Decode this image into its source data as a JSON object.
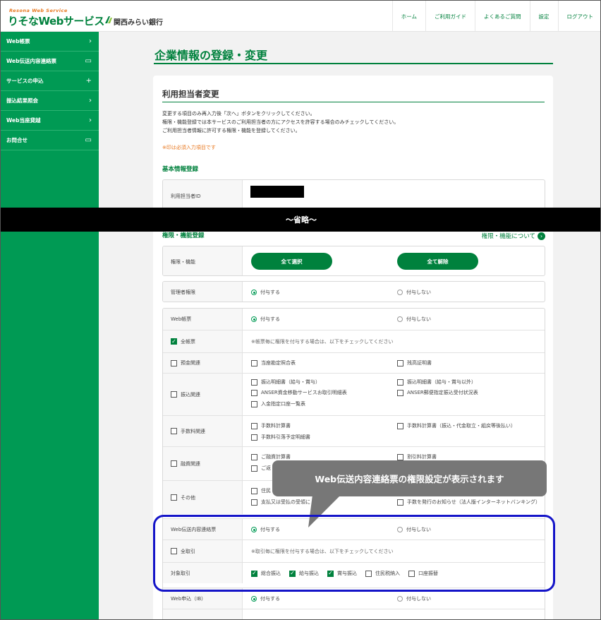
{
  "header": {
    "logo_tagline": "Resona Web Service",
    "logo_main": "りそなWebサービス",
    "bank_name": "関西みらい銀行",
    "nav": [
      "ホーム",
      "ご利用ガイド",
      "よくあるご質問",
      "設定",
      "ログアウト"
    ]
  },
  "sidebar": {
    "items": [
      {
        "label": "Web帳票",
        "icon": "chevron-right-icon",
        "glyph": "›"
      },
      {
        "label": "Web伝送内容連絡票",
        "icon": "window-icon",
        "glyph": "▭"
      },
      {
        "label": "サービスの申込",
        "icon": "plus-icon",
        "glyph": "+"
      },
      {
        "label": "振込結果照会",
        "icon": "chevron-right-icon",
        "glyph": "›"
      },
      {
        "label": "Web当座貸越",
        "icon": "chevron-right-icon",
        "glyph": "›"
      },
      {
        "label": "お問合せ",
        "icon": "window-icon",
        "glyph": "▭"
      }
    ]
  },
  "main": {
    "page_title": "企業情報の登録・変更",
    "section_title": "利用担当者変更",
    "instructions": [
      "変更する項目のみ再入力後「次へ」ボタンをクリックしてください。",
      "権限・機能登録では本サービスのご利用担当者の方にアクセスを許容する場合のみチェックしてください。",
      "ご利用担当者情報に許可する権限・機能を登録してください。"
    ],
    "required_note": "※印は必須入力項目です",
    "basic_heading": "基本情報登録",
    "user_id_label": "利用担当者ID",
    "omitted_banner": "〜省略〜",
    "auth_heading": "権限・機能登録",
    "auth_link": "権限・機能について",
    "auth_row_label": "権限・機能",
    "select_all": "全て選択",
    "clear_all": "全て解除",
    "grant": "付与する",
    "no_grant": "付与しない",
    "admin_label": "管理者権限",
    "webform_label": "Web帳票",
    "all_forms_label": "全帳票",
    "all_forms_note": "※帳票毎に権限を付与する場合は、以下をチェックしてください",
    "rows": {
      "deposit": {
        "label": "預金関連",
        "items": [
          "当座勘定照合表",
          "残高証明書"
        ]
      },
      "transfer": {
        "label": "振込関連",
        "items": [
          "振込明細書（給与・賞与）",
          "振込明細書（給与・賞与以外）",
          "ANSER資金移動サービスお取引明細表",
          "ANSER郵便指定振込受付状況表",
          "入金指定口座一覧表"
        ]
      },
      "fee": {
        "label": "手数料関連",
        "items": [
          "手数料計算書",
          "手数料計算書（振込・代金取立・組戻等後払い）",
          "手数料引落予定明細書"
        ]
      },
      "loan": {
        "label": "融資関連",
        "items": [
          "ご融資計算書",
          "割引料計算書",
          "ご返"
        ]
      },
      "other": {
        "label": "その他",
        "items": [
          "住民",
          "支払又は受払の受領に",
          "手数を発行のお知らせ（法人版インターネットバンキング）"
        ]
      }
    },
    "dentsou_label": "Web伝送内容連絡票",
    "all_tx_label": "全取引",
    "all_tx_note": "※取引毎に権限を付与する場合は、以下をチェックしてください",
    "target_label": "対象取引",
    "targets": [
      {
        "label": "総合振込",
        "checked": true
      },
      {
        "label": "給与振込",
        "checked": true
      },
      {
        "label": "賞与振込",
        "checked": true
      },
      {
        "label": "住民税納入",
        "checked": false
      },
      {
        "label": "口座振替",
        "checked": false
      }
    ],
    "web_apply_label": "Web申込（IB）"
  },
  "callout_text": "Web伝送内容連絡票の権限設定が表示されます",
  "colors": {
    "brand_green": "#009a54",
    "dark_green": "#00813d",
    "orange": "#e8771e",
    "highlight_blue": "#1414c8"
  }
}
